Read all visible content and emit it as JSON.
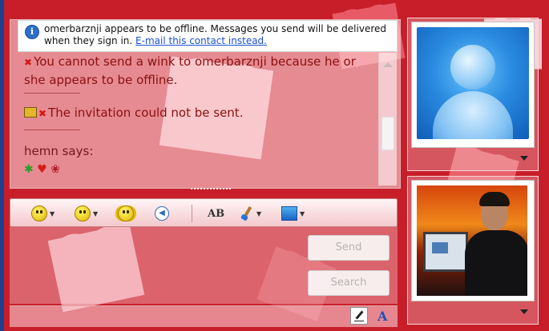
{
  "info_bar": {
    "message": "omerbarznji appears to be offline. Messages you send will be delivered when they sign in.",
    "link": "E-mail this contact instead."
  },
  "history": {
    "messages": [
      {
        "text": "You cannot send a wink to omerbarznji because he or she appears to be offline.",
        "icon": "x-icon"
      },
      {
        "text": "The invitation could not be sent.",
        "icon": "envelope-x-icon"
      }
    ],
    "sender_line": "hemn says:",
    "sender_emoticons": [
      "dancing-figure-icon",
      "heart-icon",
      "rose-icon"
    ]
  },
  "toolbar": {
    "buttons": [
      {
        "name": "emoticon-button",
        "icon": "smiley-icon"
      },
      {
        "name": "wink-button",
        "icon": "wink-icon"
      },
      {
        "name": "nudge-button",
        "icon": "nudge-icon"
      },
      {
        "name": "voice-clip-button",
        "icon": "speaker-icon"
      },
      {
        "name": "font-button",
        "icon": "font-icon",
        "label": "AB"
      },
      {
        "name": "background-color-button",
        "icon": "brush-icon"
      },
      {
        "name": "backgrounds-button",
        "icon": "backgrounds-icon"
      }
    ]
  },
  "actions": {
    "send_label": "Send",
    "search_label": "Search"
  },
  "bottom": {
    "font_label": "A"
  },
  "colors": {
    "message_text": "#8a1010",
    "link": "#1b4fd6",
    "background": "#c81e2a"
  }
}
